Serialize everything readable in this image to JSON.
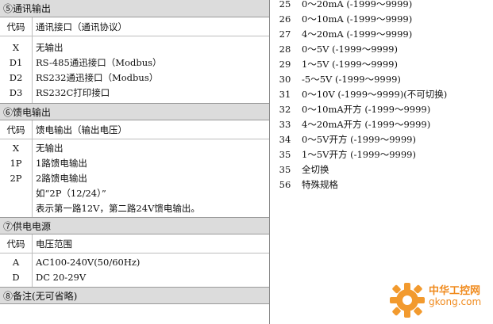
{
  "section5": {
    "title": "⑤通讯输出",
    "header": {
      "code": "代码",
      "desc": "通讯接口（通讯协议）"
    },
    "rows": [
      {
        "code": "X",
        "desc": "无输出"
      },
      {
        "code": "D1",
        "desc": "RS-485通迅接口（Modbus）"
      },
      {
        "code": "D2",
        "desc": "RS232通迅接口（Modbus）"
      },
      {
        "code": "D3",
        "desc": "RS232C打印接口"
      }
    ]
  },
  "section6": {
    "title": "⑥馈电输出",
    "header": {
      "code": "代码",
      "desc": "馈电输出（输出电压）"
    },
    "rows": [
      {
        "code": "X",
        "desc": "无输出"
      },
      {
        "code": "1P",
        "desc": "1路馈电输出"
      },
      {
        "code": "2P",
        "desc": "2路馈电输出"
      },
      {
        "code": "",
        "desc": "如“2P（12/24）”"
      },
      {
        "code": "",
        "desc": "表示第一路12V，第二路24V馈电输出。"
      }
    ]
  },
  "section7": {
    "title": "⑦供电电源",
    "header": {
      "code": "代码",
      "desc": "电压范围"
    },
    "rows": [
      {
        "code": "A",
        "desc": "AC100-240V(50/60Hz)"
      },
      {
        "code": "D",
        "desc": "DC 20-29V"
      }
    ]
  },
  "section8": {
    "title": "⑧备注(无可省略)"
  },
  "right_list": [
    {
      "code": "25",
      "desc": "0～20mA (-1999～9999)"
    },
    {
      "code": "26",
      "desc": "0～10mA (-1999～9999)"
    },
    {
      "code": "27",
      "desc": "4～20mA (-1999～9999)"
    },
    {
      "code": "28",
      "desc": "0～5V (-1999～9999)"
    },
    {
      "code": "29",
      "desc": "1～5V (-1999～9999)"
    },
    {
      "code": "30",
      "desc": "-5～5V (-1999～9999)"
    },
    {
      "code": "31",
      "desc": "0～10V (-1999～9999)(不可切换)"
    },
    {
      "code": "32",
      "desc": "0～10mA开方 (-1999～9999)"
    },
    {
      "code": "33",
      "desc": "4～20mA开方 (-1999～9999)"
    },
    {
      "code": "34",
      "desc": "0～5V开方 (-1999～9999)"
    },
    {
      "code": "35",
      "desc": "1～5V开方 (-1999～9999)"
    },
    {
      "code": "35",
      "desc": "全切换"
    },
    {
      "code": "56",
      "desc": "特殊规格"
    }
  ],
  "watermark": {
    "line1": "中华工控网",
    "line2": "gkong.com"
  }
}
